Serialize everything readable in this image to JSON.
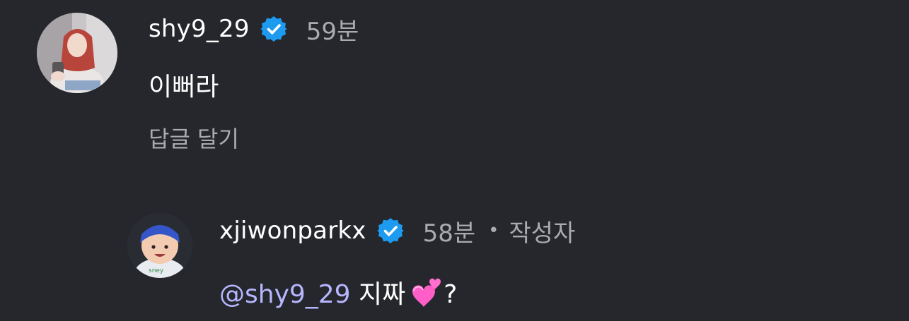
{
  "comments": [
    {
      "username": "shy9_29",
      "time": "59분",
      "text": "이뻐라",
      "reply_label": "답글 달기"
    }
  ],
  "replies": [
    {
      "username": "xjiwonparkx",
      "time": "58분",
      "separator": "•",
      "author_label": "작성자",
      "mention": "@shy9_29",
      "text": "지짜",
      "trailing": "?"
    }
  ],
  "icons": {
    "verified": "verified-badge-icon",
    "emoji": "two-hearts-emoji"
  },
  "colors": {
    "background": "#25272c",
    "verified": "#1d9bf0",
    "mention": "#b7b6ff",
    "muted": "#a9abb1"
  }
}
